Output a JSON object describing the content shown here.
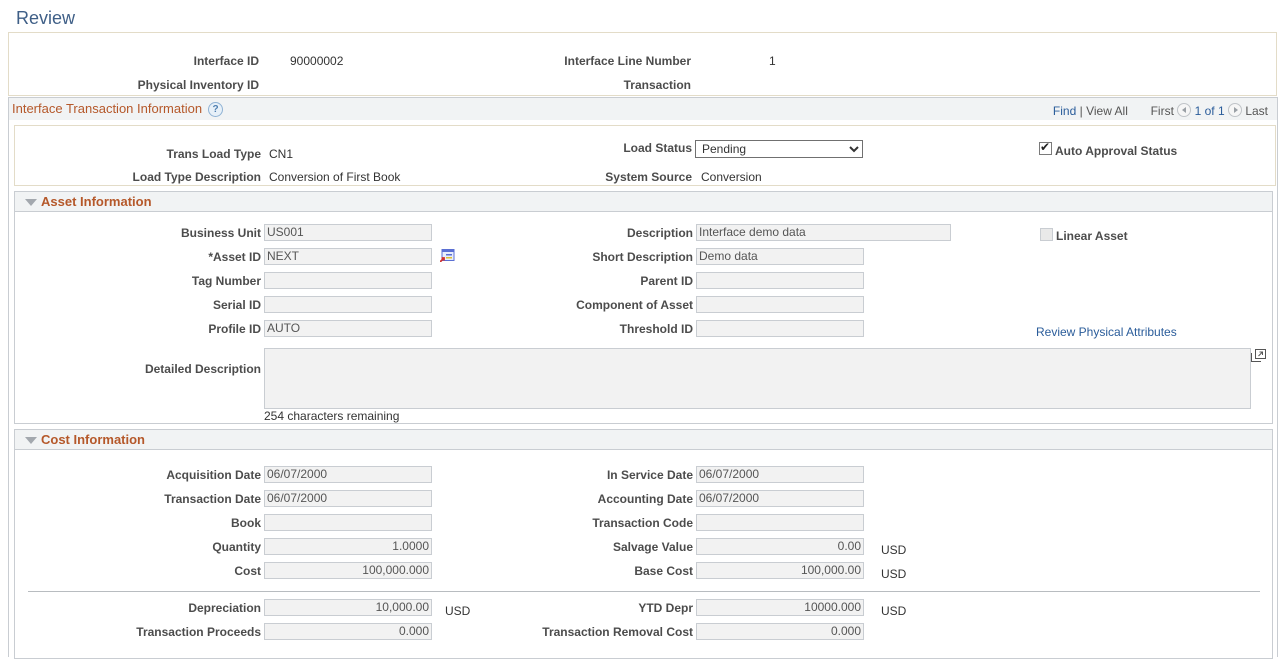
{
  "page_title": "Review",
  "header": {
    "interface_id_label": "Interface ID",
    "interface_id_value": "90000002",
    "physical_inventory_id_label": "Physical Inventory ID",
    "physical_inventory_id_value": "",
    "interface_line_number_label": "Interface Line Number",
    "interface_line_number_value": "1",
    "transaction_label": "Transaction",
    "transaction_value": ""
  },
  "grid": {
    "title": "Interface Transaction Information",
    "help_icon": "?",
    "find": "Find",
    "separator": "|",
    "view_all": "View All",
    "first": "First",
    "page_of": "1 of 1",
    "last": "Last"
  },
  "transaction": {
    "trans_load_type_label": "Trans Load Type",
    "trans_load_type_value": "CN1",
    "load_type_description_label": "Load Type Description",
    "load_type_description_value": "Conversion of First Book",
    "load_status_label": "Load Status",
    "load_status_value": "Pending",
    "system_source_label": "System Source",
    "system_source_value": "Conversion",
    "auto_approval_label": "Auto Approval Status",
    "auto_approval_checked": true
  },
  "asset_info": {
    "section_title": "Asset Information",
    "business_unit_label": "Business Unit",
    "business_unit_value": "US001",
    "asset_id_label": "*Asset ID",
    "asset_id_value": "NEXT",
    "tag_number_label": "Tag Number",
    "tag_number_value": "",
    "serial_id_label": "Serial ID",
    "serial_id_value": "",
    "profile_id_label": "Profile ID",
    "profile_id_value": "AUTO",
    "description_label": "Description",
    "description_value": "Interface demo data",
    "short_description_label": "Short Description",
    "short_description_value": "Demo data",
    "parent_id_label": "Parent ID",
    "parent_id_value": "",
    "component_of_asset_label": "Component of Asset",
    "component_of_asset_value": "",
    "threshold_id_label": "Threshold ID",
    "threshold_id_value": "",
    "linear_asset_label": "Linear Asset",
    "linear_asset_checked": false,
    "review_physical_attributes": "Review Physical Attributes",
    "detailed_description_label": "Detailed Description",
    "detailed_description_value": "",
    "chars_remaining": "254 characters remaining"
  },
  "cost_info": {
    "section_title": "Cost Information",
    "acquisition_date_label": "Acquisition Date",
    "acquisition_date_value": "06/07/2000",
    "transaction_date_label": "Transaction Date",
    "transaction_date_value": "06/07/2000",
    "book_label": "Book",
    "book_value": "",
    "quantity_label": "Quantity",
    "quantity_value": "1.0000",
    "cost_label": "Cost",
    "cost_value": "100,000.000",
    "in_service_date_label": "In Service Date",
    "in_service_date_value": "06/07/2000",
    "accounting_date_label": "Accounting Date",
    "accounting_date_value": "06/07/2000",
    "transaction_code_label": "Transaction Code",
    "transaction_code_value": "",
    "salvage_value_label": "Salvage Value",
    "salvage_value_value": "0.00",
    "salvage_currency": "USD",
    "base_cost_label": "Base Cost",
    "base_cost_value": "100,000.00",
    "base_cost_currency": "USD",
    "depreciation_label": "Depreciation",
    "depreciation_value": "10,000.00",
    "depreciation_currency": "USD",
    "transaction_proceeds_label": "Transaction Proceeds",
    "transaction_proceeds_value": "0.000",
    "ytd_depr_label": "YTD Depr",
    "ytd_depr_value": "10000.000",
    "ytd_depr_currency": "USD",
    "transaction_removal_cost_label": "Transaction Removal Cost",
    "transaction_removal_cost_value": "0.000"
  }
}
